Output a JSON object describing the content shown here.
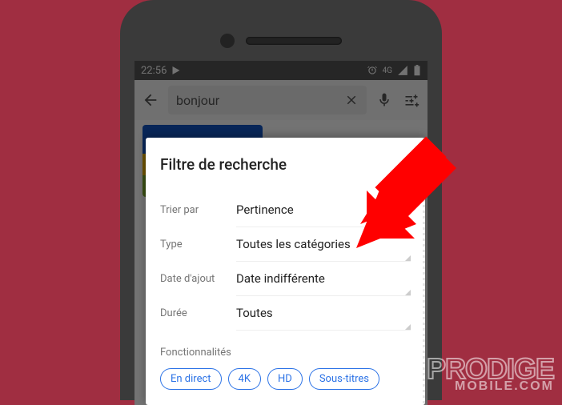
{
  "status": {
    "time": "22:56",
    "network_label": "4G"
  },
  "search": {
    "query": "bonjour"
  },
  "modal": {
    "title": "Filtre de recherche",
    "rows": [
      {
        "label": "Trier par",
        "value": "Pertinence"
      },
      {
        "label": "Type",
        "value": "Toutes les catégories"
      },
      {
        "label": "Date d'ajout",
        "value": "Date indifférente"
      },
      {
        "label": "Durée",
        "value": "Toutes"
      }
    ],
    "features_label": "Fonctionnalités",
    "chips": [
      "En direct",
      "4K",
      "HD",
      "Sous-titres"
    ]
  },
  "watermark": {
    "line1": "PRODIGE",
    "line2": "MOBILE.COM"
  },
  "thumb_colors": [
    "#1255c4",
    "#f0b400",
    "#7fae2a"
  ]
}
